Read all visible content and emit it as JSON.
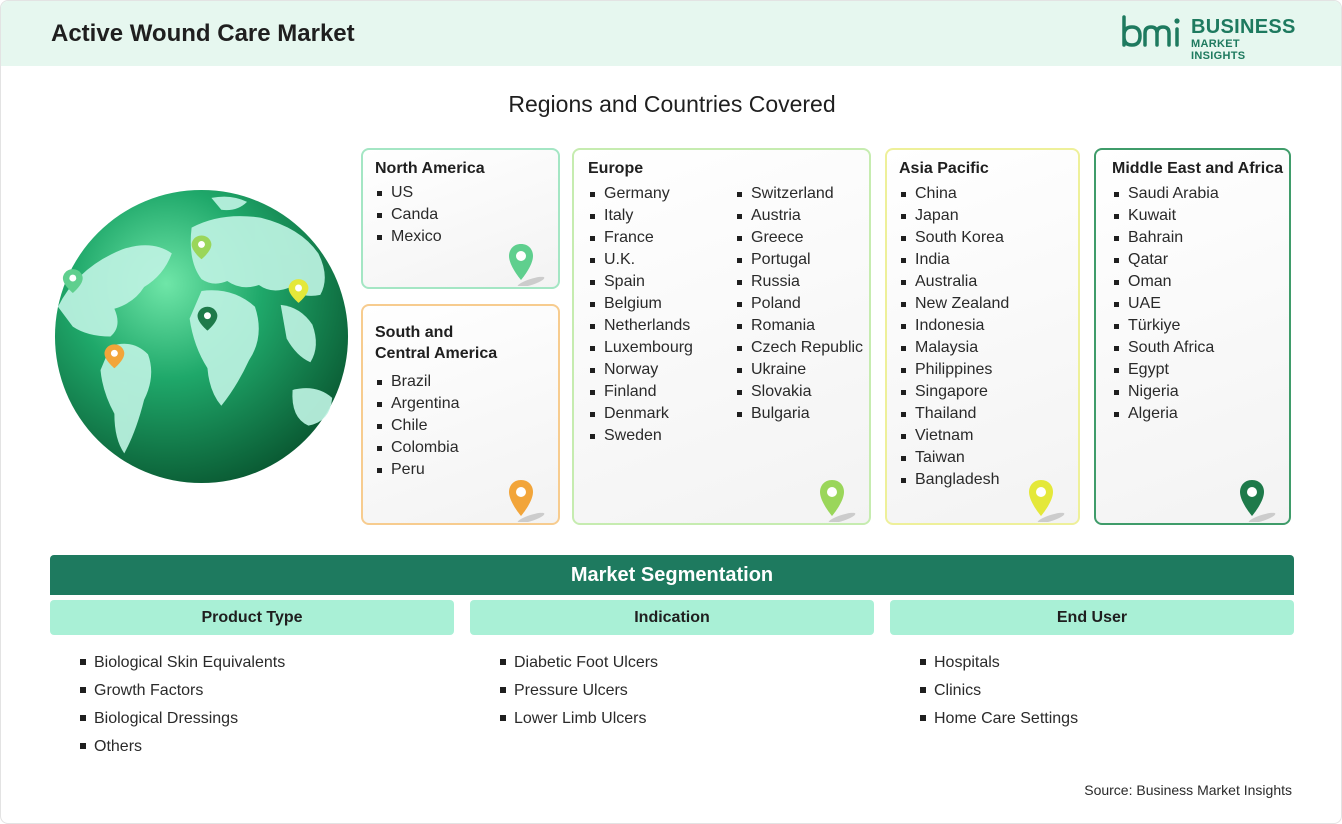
{
  "header": {
    "title": "Active Wound Care Market"
  },
  "logo": {
    "line1": "BUSINESS",
    "line2": "MARKET INSIGHTS",
    "mark": "bmi"
  },
  "regions": {
    "title": "Regions and Countries Covered",
    "north_america": {
      "title": "North America",
      "items": [
        "US",
        "Canda",
        "Mexico"
      ],
      "color": "#5fcf8e"
    },
    "south_america": {
      "title": "South and\nCentral America",
      "title_line1": "South and",
      "title_line2": "Central America",
      "items": [
        "Brazil",
        "Argentina",
        "Chile",
        "Colombia",
        "Peru"
      ],
      "color": "#f2a53a"
    },
    "europe": {
      "title": "Europe",
      "col1": [
        "Germany",
        "Italy",
        "France",
        "U.K.",
        "Spain",
        "Belgium",
        "Netherlands",
        "Luxembourg",
        "Norway",
        "Finland",
        "Denmark",
        "Sweden"
      ],
      "col2": [
        "Switzerland",
        "Austria",
        "Greece",
        "Portugal",
        "Russia",
        "Poland",
        "Romania",
        "Czech Republic",
        "Ukraine",
        "Slovakia",
        "Bulgaria"
      ],
      "color": "#9ad65a"
    },
    "asia_pacific": {
      "title": "Asia Pacific",
      "items": [
        "China",
        "Japan",
        "South Korea",
        "India",
        "Australia",
        "New Zealand",
        "Indonesia",
        "Malaysia",
        "Philippines",
        "Singapore",
        "Thailand",
        "Vietnam",
        "Taiwan",
        "Bangladesh"
      ],
      "color": "#e4e83a"
    },
    "mea": {
      "title": "Middle East and Africa",
      "items": [
        "Saudi Arabia",
        "Kuwait",
        "Bahrain",
        "Qatar",
        "Oman",
        "UAE",
        "Türkiye",
        "South Africa",
        "Egypt",
        "Nigeria",
        "Algeria"
      ],
      "color": "#1e7a4a"
    }
  },
  "segmentation": {
    "title": "Market Segmentation",
    "product_type": {
      "title": "Product Type",
      "items": [
        "Biological Skin Equivalents",
        "Growth Factors",
        "Biological Dressings",
        "Others"
      ]
    },
    "indication": {
      "title": "Indication",
      "items": [
        "Diabetic Foot Ulcers",
        "Pressure Ulcers",
        "Lower Limb Ulcers"
      ]
    },
    "end_user": {
      "title": "End User",
      "items": [
        "Hospitals",
        "Clinics",
        "Home Care Settings"
      ]
    }
  },
  "source": "Source: Business Market Insights",
  "icons": [
    "map-pin-icon",
    "globe-icon",
    "bmi-logo"
  ],
  "colors": {
    "brand_green": "#1e7a5f",
    "header_bg": "#e6f7ef",
    "segment_head_bg": "#a9f0d6"
  }
}
